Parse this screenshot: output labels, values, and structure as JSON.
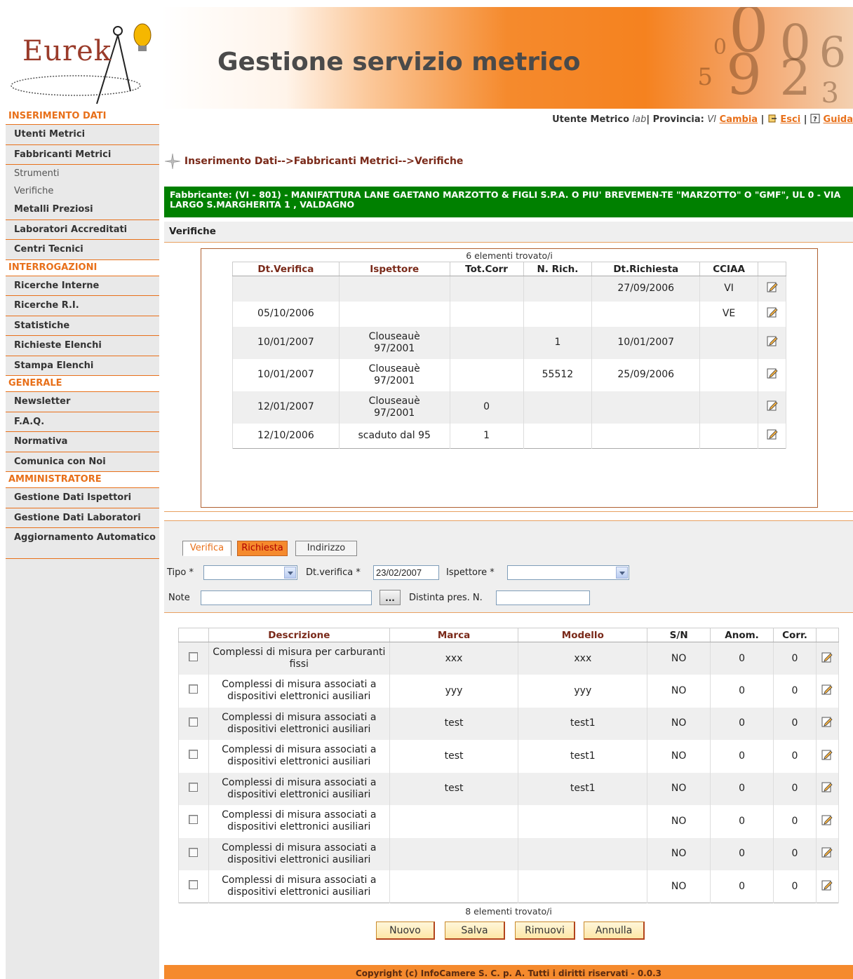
{
  "header": {
    "logo_text": "Eurek",
    "title": "Gestione servizio metrico",
    "colors": {
      "accent": "#f5821f",
      "green": "#008000",
      "link": "#e8701a"
    }
  },
  "sidebar": {
    "sections": [
      {
        "label": "INSERIMENTO DATI",
        "items": [
          {
            "label": "Utenti Metrici",
            "kind": "item"
          },
          {
            "label": "Fabbricanti Metrici",
            "kind": "item"
          },
          {
            "label": "Strumenti",
            "kind": "sub"
          },
          {
            "label": "Verifiche",
            "kind": "sub"
          },
          {
            "label": "Metalli Preziosi",
            "kind": "item"
          },
          {
            "label": "Laboratori Accreditati",
            "kind": "item"
          },
          {
            "label": "Centri Tecnici",
            "kind": "item"
          }
        ]
      },
      {
        "label": "INTERROGAZIONI",
        "items": [
          {
            "label": "Ricerche Interne",
            "kind": "item"
          },
          {
            "label": "Ricerche R.I.",
            "kind": "item"
          },
          {
            "label": "Statistiche",
            "kind": "item"
          },
          {
            "label": "Richieste Elenchi",
            "kind": "item"
          },
          {
            "label": "Stampa Elenchi",
            "kind": "item"
          }
        ]
      },
      {
        "label": "GENERALE",
        "items": [
          {
            "label": "Newsletter",
            "kind": "item"
          },
          {
            "label": "F.A.Q.",
            "kind": "item"
          },
          {
            "label": "Normativa",
            "kind": "item"
          },
          {
            "label": "Comunica con Noi",
            "kind": "item"
          }
        ]
      },
      {
        "label": "AMMINISTRATORE",
        "items": [
          {
            "label": "Gestione Dati Ispettori",
            "kind": "item"
          },
          {
            "label": "Gestione Dati Laboratori",
            "kind": "item"
          },
          {
            "label": "Aggiornamento Automatico",
            "kind": "item2"
          }
        ]
      }
    ]
  },
  "userbar": {
    "utente_label": "Utente Metrico",
    "utente_value": "lab",
    "provincia_label": "Provincia:",
    "provincia_value": "VI",
    "cambia": "Cambia",
    "esci": "Esci",
    "guida": "Guida"
  },
  "breadcrumb": "Inserimento Dati-->Fabbricanti Metrici-->Verifiche",
  "fabbricante": "Fabbricante: (VI - 801) - MANIFATTURA LANE GAETANO MARZOTTO & FIGLI S.P.A. O PIU' BREVEMEN-TE \"MARZOTTO\" O \"GMF\", UL 0 - VIA LARGO S.MARGHERITA 1 , VALDAGNO",
  "section_title": "Verifiche",
  "verifiche": {
    "count": "6 elementi trovato/i",
    "headers": [
      "Dt.Verifica",
      "Ispettore",
      "Tot.Corr",
      "N. Rich.",
      "Dt.Richiesta",
      "CCIAA",
      ""
    ],
    "rows": [
      [
        "",
        "",
        "",
        "",
        "27/09/2006",
        "VI"
      ],
      [
        "05/10/2006",
        "",
        "",
        "",
        "",
        "VE"
      ],
      [
        "10/01/2007",
        "Clouseauè 97/2001",
        "",
        "1",
        "10/01/2007",
        ""
      ],
      [
        "10/01/2007",
        "Clouseauè 97/2001",
        "",
        "55512",
        "25/09/2006",
        ""
      ],
      [
        "12/01/2007",
        "Clouseauè 97/2001",
        "0",
        "",
        "",
        ""
      ],
      [
        "12/10/2006",
        "scaduto dal 95",
        "1",
        "",
        "",
        ""
      ]
    ]
  },
  "form": {
    "tabs": [
      "Verifica",
      "Richiesta",
      "Indirizzo"
    ],
    "tipo_label": "Tipo *",
    "tipo_value": "",
    "dtverifica_label": "Dt.verifica *",
    "dtverifica_value": "23/02/2007",
    "ispettore_label": "Ispettore *",
    "ispettore_value": "",
    "note_label": "Note",
    "note_value": "",
    "dots": "...",
    "distinta_label": "Distinta pres. N.",
    "distinta_value": ""
  },
  "strumenti": {
    "headers": [
      "",
      "Descrizione",
      "Marca",
      "Modello",
      "S/N",
      "Anom.",
      "Corr.",
      ""
    ],
    "rows": [
      [
        "Complessi di misura per carburanti fissi",
        "xxx",
        "xxx",
        "NO",
        "0",
        "0"
      ],
      [
        "Complessi di misura associati a dispositivi elettronici ausiliari",
        "yyy",
        "yyy",
        "NO",
        "0",
        "0"
      ],
      [
        "Complessi di misura associati a dispositivi elettronici ausiliari",
        "test",
        "test1",
        "NO",
        "0",
        "0"
      ],
      [
        "Complessi di misura associati a dispositivi elettronici ausiliari",
        "test",
        "test1",
        "NO",
        "0",
        "0"
      ],
      [
        "Complessi di misura associati a dispositivi elettronici ausiliari",
        "test",
        "test1",
        "NO",
        "0",
        "0"
      ],
      [
        "Complessi di misura associati a dispositivi elettronici ausiliari",
        "",
        "",
        "NO",
        "0",
        "0"
      ],
      [
        "Complessi di misura associati a dispositivi elettronici ausiliari",
        "",
        "",
        "NO",
        "0",
        "0"
      ],
      [
        "Complessi di misura associati a dispositivi elettronici ausiliari",
        "",
        "",
        "NO",
        "0",
        "0"
      ]
    ],
    "count": "8 elementi trovato/i"
  },
  "buttons": {
    "nuovo": "Nuovo",
    "salva": "Salva",
    "rimuovi": "Rimuovi",
    "annulla": "Annulla"
  },
  "footer": "Copyright (c) InfoCamere S. C. p. A. Tutti i diritti riservati - 0.0.3"
}
